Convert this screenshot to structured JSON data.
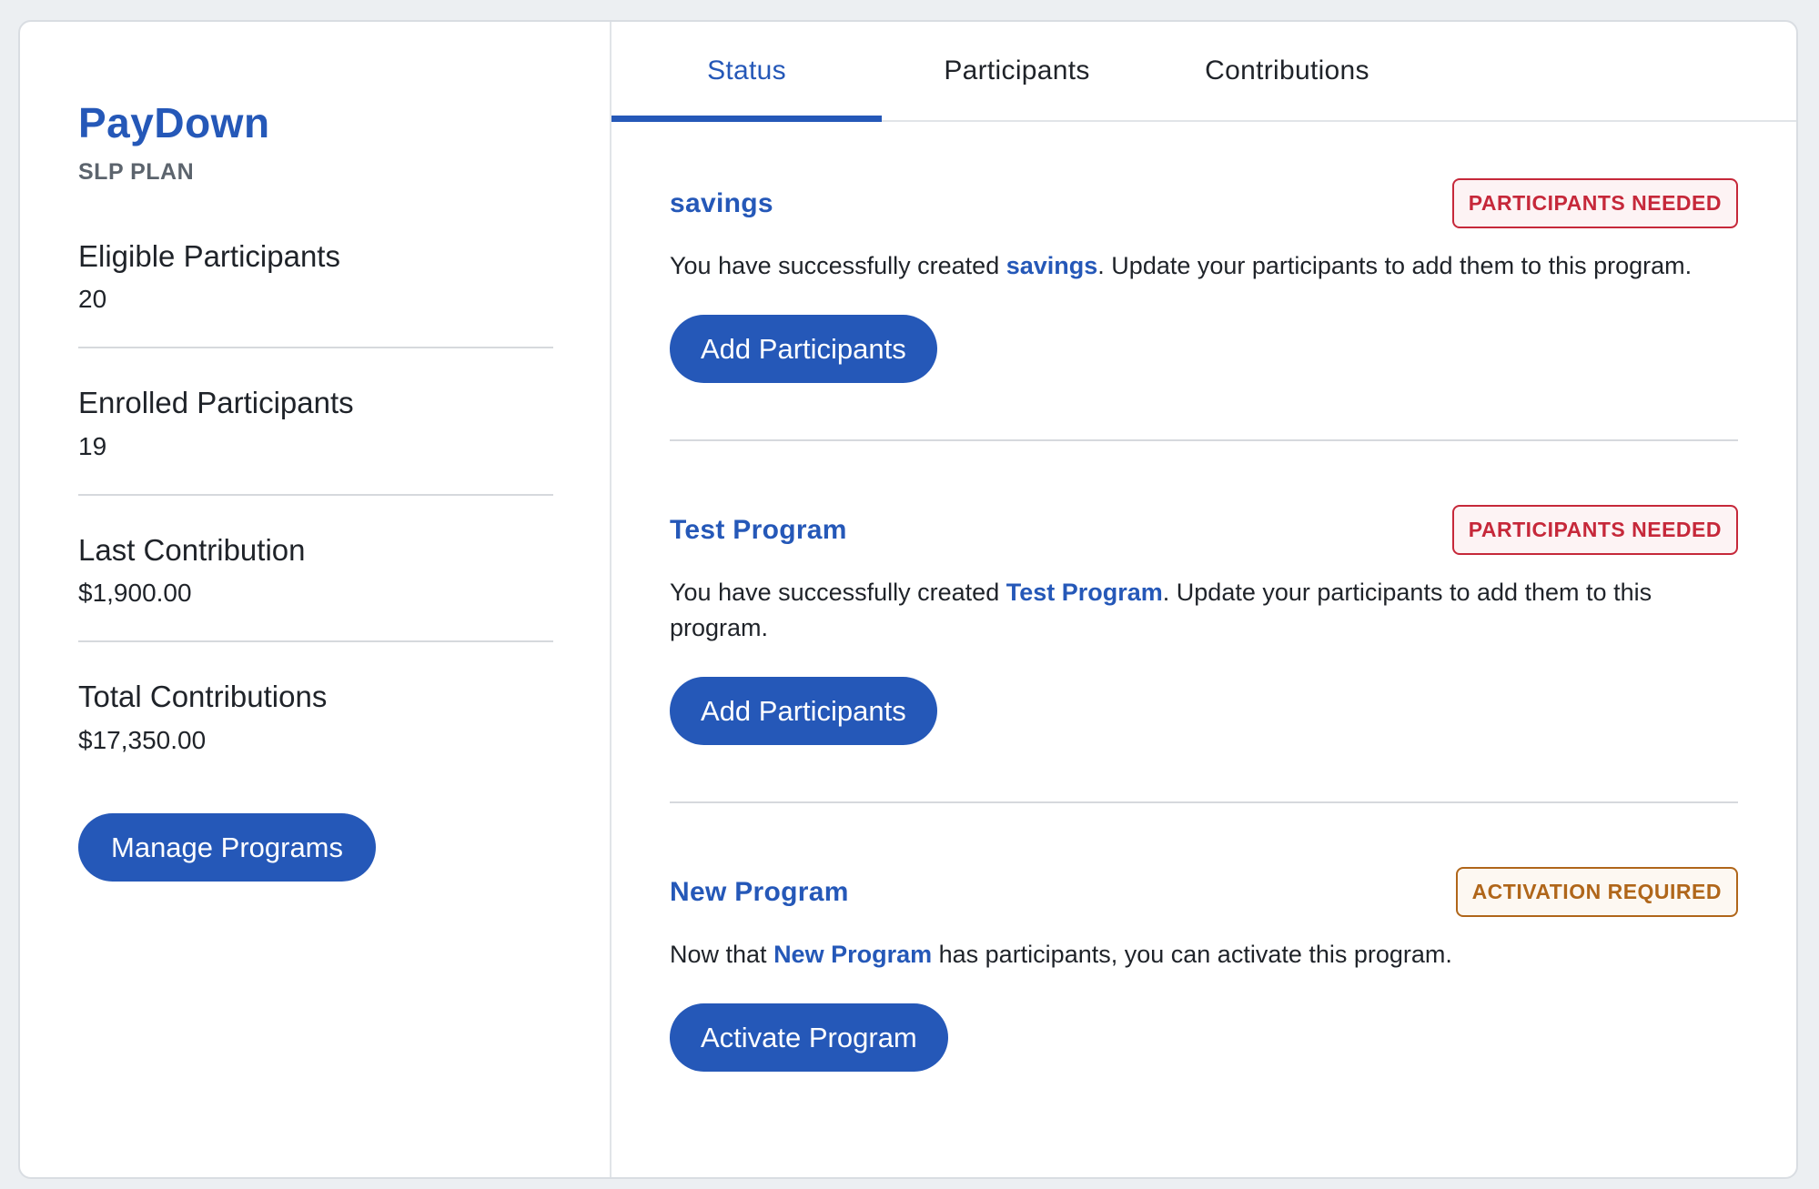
{
  "sidebar": {
    "brand_title": "PayDown",
    "brand_subtitle": "SLP PLAN",
    "stats": [
      {
        "label": "Eligible Participants",
        "value": "20"
      },
      {
        "label": "Enrolled Participants",
        "value": "19"
      },
      {
        "label": "Last Contribution",
        "value": "$1,900.00"
      },
      {
        "label": "Total Contributions",
        "value": "$17,350.00"
      }
    ],
    "manage_button_label": "Manage Programs"
  },
  "tabs": [
    {
      "label": "Status",
      "active": true
    },
    {
      "label": "Participants",
      "active": false
    },
    {
      "label": "Contributions",
      "active": false
    }
  ],
  "programs": [
    {
      "name": "savings",
      "badge": "PARTICIPANTS NEEDED",
      "text_before": "You have successfully created ",
      "text_name": "savings",
      "text_after": ". Update your participants to add them to this program.",
      "button_label": "Add Participants"
    },
    {
      "name": "Test Program",
      "badge": "PARTICIPANTS NEEDED",
      "text_before": "You have successfully created ",
      "text_name": "Test Program",
      "text_after": ". Update your participants to add them to this program.",
      "button_label": "Add Participants"
    },
    {
      "name": "New Program",
      "badge": "ACTIVATION REQUIRED",
      "text_before": "Now that ",
      "text_name": "New Program",
      "text_after": " has participants, you can activate this program.",
      "button_label": "Activate Program"
    }
  ],
  "colors": {
    "accent": "#2558b8",
    "badge_needed": "#c6283a",
    "badge_activation": "#b0661a"
  }
}
